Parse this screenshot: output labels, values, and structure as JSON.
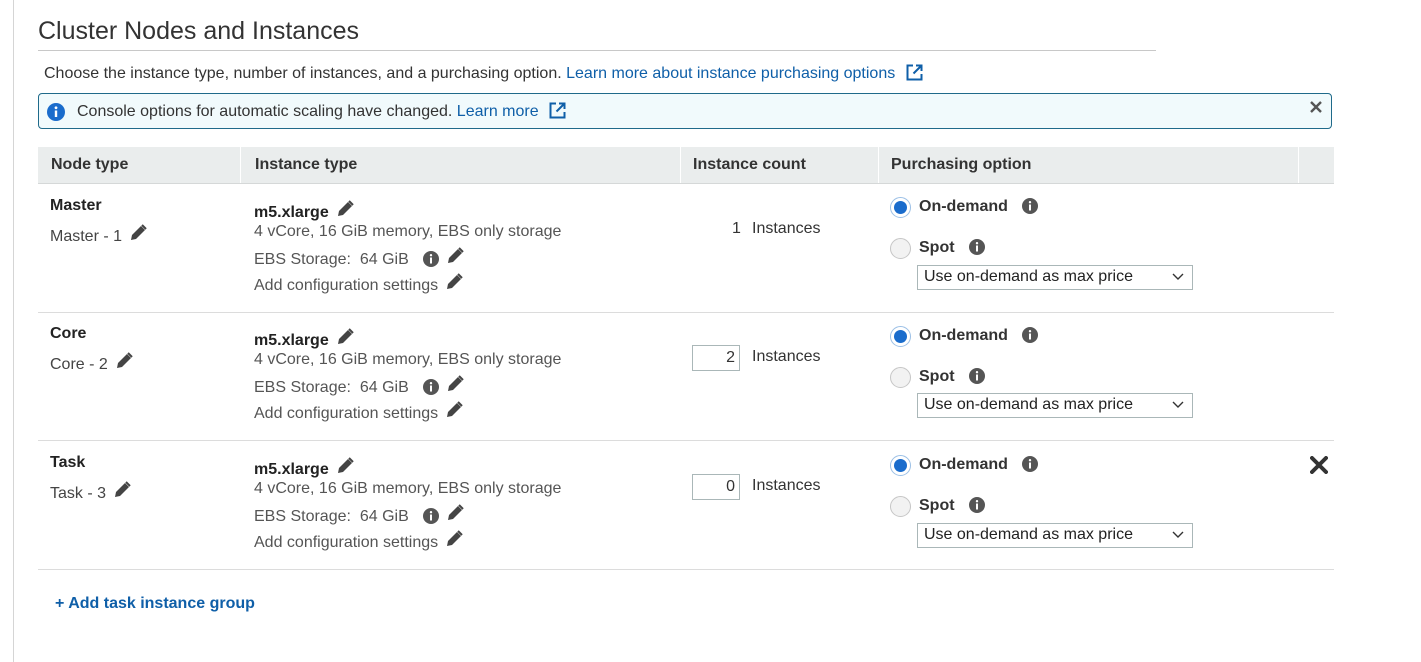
{
  "section": {
    "title": "Cluster Nodes and Instances",
    "description": "Choose the instance type, number of instances, and a purchasing option.",
    "learn_more_link": "Learn more about instance purchasing options"
  },
  "notice": {
    "message": "Console options for automatic scaling have changed.",
    "link": "Learn more"
  },
  "table": {
    "headers": {
      "node_type": "Node type",
      "instance_type": "Instance type",
      "instance_count": "Instance count",
      "purchasing_option": "Purchasing option"
    },
    "rows": [
      {
        "node": "Master",
        "group": "Master - 1",
        "instance": "m5.xlarge",
        "spec": "4 vCore, 16 GiB memory, EBS only storage",
        "ebs_label": "EBS Storage:",
        "ebs_value": "64 GiB",
        "config": "Add configuration settings",
        "count": "1",
        "count_unit": "Instances",
        "ondemand": "On-demand",
        "spot": "Spot",
        "max_price": "Use on-demand as max price"
      },
      {
        "node": "Core",
        "group": "Core - 2",
        "instance": "m5.xlarge",
        "spec": "4 vCore, 16 GiB memory, EBS only storage",
        "ebs_label": "EBS Storage:",
        "ebs_value": "64 GiB",
        "config": "Add configuration settings",
        "count": "2",
        "count_unit": "Instances",
        "ondemand": "On-demand",
        "spot": "Spot",
        "max_price": "Use on-demand as max price"
      },
      {
        "node": "Task",
        "group": "Task - 3",
        "instance": "m5.xlarge",
        "spec": "4 vCore, 16 GiB memory, EBS only storage",
        "ebs_label": "EBS Storage:",
        "ebs_value": "64 GiB",
        "config": "Add configuration settings",
        "count": "0",
        "count_unit": "Instances",
        "ondemand": "On-demand",
        "spot": "Spot",
        "max_price": "Use on-demand as max price"
      }
    ]
  },
  "add_task_group": "+ Add task instance group",
  "colors": {
    "link": "#0f5fa8",
    "radio_selected": "#1a6ccc",
    "notice_border": "#1f6a8a",
    "header_bg": "#eaeded"
  },
  "icons": [
    "info-icon",
    "external-link-icon",
    "close-icon",
    "pencil-icon",
    "remove-icon",
    "chevron-down-icon"
  ]
}
